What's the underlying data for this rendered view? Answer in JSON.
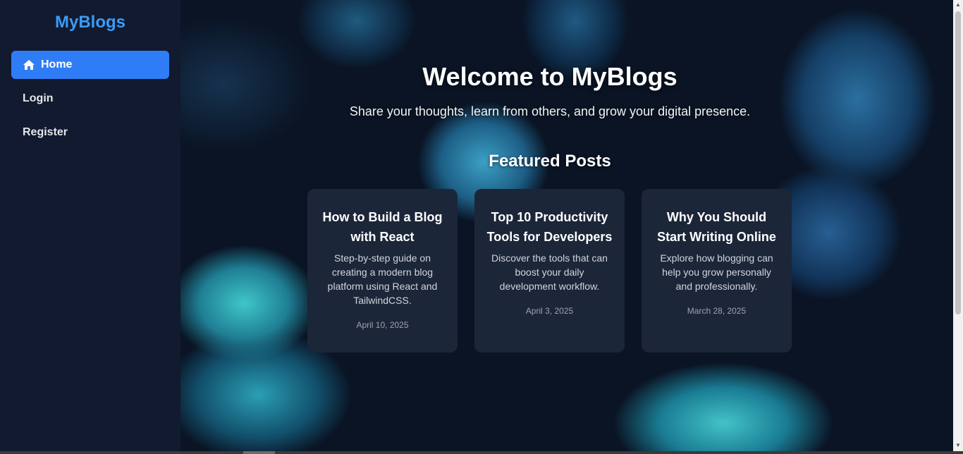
{
  "sidebar": {
    "brand": "MyBlogs",
    "items": [
      {
        "label": "Home",
        "icon": "home-icon",
        "active": true
      },
      {
        "label": "Login"
      },
      {
        "label": "Register"
      }
    ]
  },
  "hero": {
    "title": "Welcome to MyBlogs",
    "subtitle": "Share your thoughts, learn from others, and grow your digital presence."
  },
  "featured": {
    "title": "Featured Posts",
    "posts": [
      {
        "title": "How to Build a Blog with React",
        "description": "Step-by-step guide on creating a modern blog platform using React and TailwindCSS.",
        "date": "April 10, 2025"
      },
      {
        "title": "Top 10 Productivity Tools for Developers",
        "description": "Discover the tools that can boost your daily development workflow.",
        "date": "April 3, 2025"
      },
      {
        "title": "Why You Should Start Writing Online",
        "description": "Explore how blogging can help you grow personally and professionally.",
        "date": "March 28, 2025"
      }
    ]
  },
  "colors": {
    "accent": "#2f7df6",
    "brand": "#3b9cf6",
    "sidebar_bg": "#111a2e",
    "card_bg": "#1c2639"
  }
}
